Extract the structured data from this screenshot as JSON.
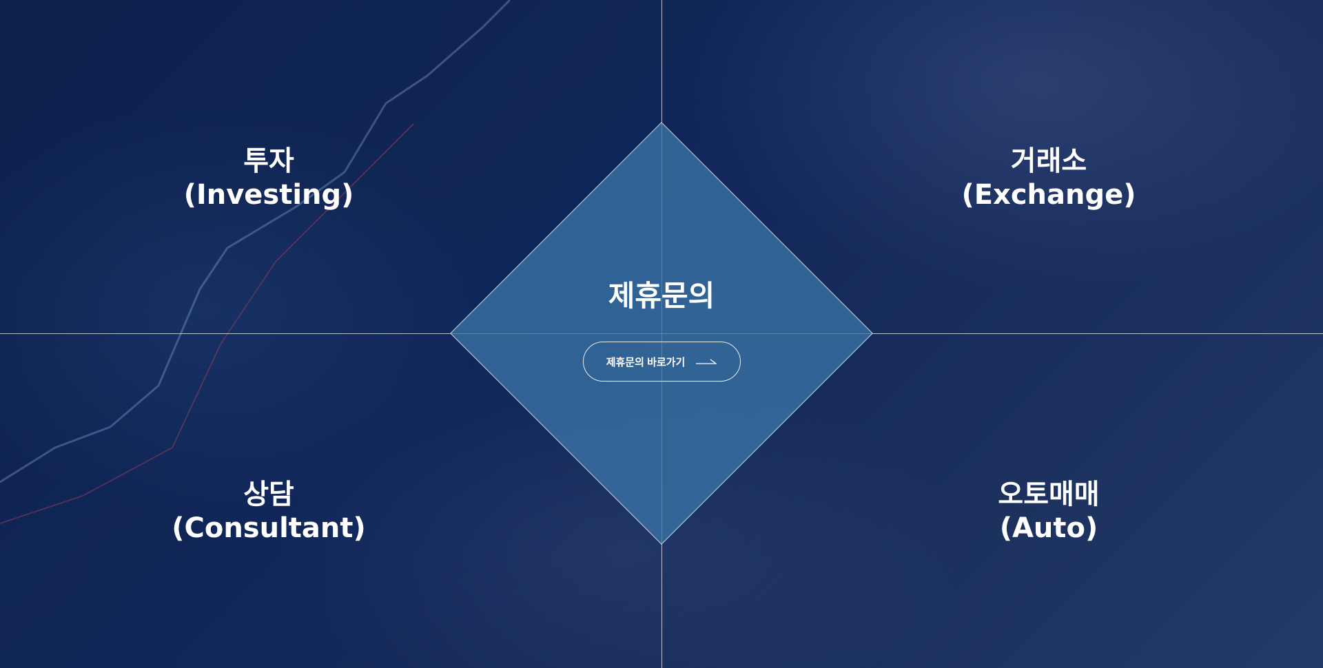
{
  "quadrants": [
    {
      "korean": "투자",
      "english": "(Investing)"
    },
    {
      "korean": "거래소",
      "english": "(Exchange)"
    },
    {
      "korean": "상담",
      "english": "(Consultant)"
    },
    {
      "korean": "오토매매",
      "english": "(Auto)"
    }
  ],
  "center": {
    "title": "제휴문의",
    "button_label": "제휴문의 바로가기",
    "button_icon": "arrow-right-icon"
  },
  "colors": {
    "background": "#0c214b",
    "diamond": "#33618c",
    "text": "#ffffff"
  }
}
